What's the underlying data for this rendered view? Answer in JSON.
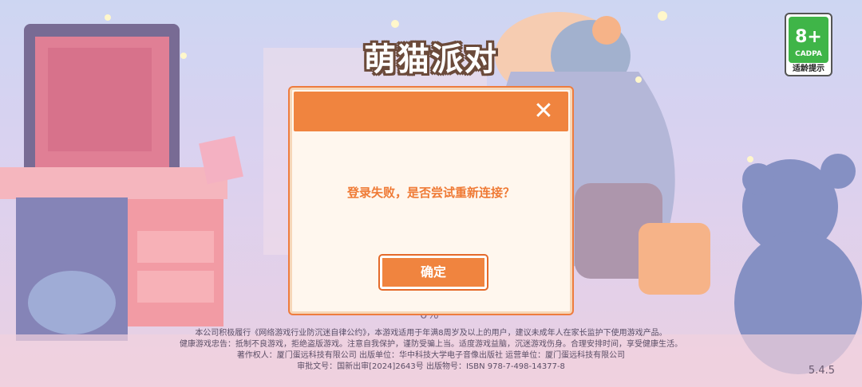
{
  "game": {
    "title": "萌猫派对"
  },
  "age_rating": {
    "age": "8+",
    "org": "CADPA",
    "hint": "适龄提示"
  },
  "dialog": {
    "close_symbol": "✕",
    "message": "登录失败，是否尝试重新连接？",
    "confirm_label": "确定"
  },
  "loading": {
    "progress_text": "0%"
  },
  "footer": {
    "lines": [
      "本公司积极履行《网络游戏行业防沉迷自律公约》，本游戏适用于年满8周岁及以上的用户，建议未成年人在家长监护下使用游戏产品。",
      "健康游戏忠告：抵制不良游戏，拒绝盗版游戏。注意自我保护，谨防受骗上当。适度游戏益脑，沉迷游戏伤身。合理安排时间，享受健康生活。",
      "著作权人：厦门蛋远科技有限公司 出版单位：华中科技大学电子音像出版社 运营单位：厦门蛋远科技有限公司",
      "审批文号：国新出审[2024]2643号 出版物号：ISBN 978-7-498-14377-8"
    ]
  },
  "version": "5.4.5",
  "colors": {
    "accent": "#f0843f",
    "text_accent": "#ef7a35",
    "badge_green": "#3fb548"
  },
  "icons": {
    "close": "close-icon"
  }
}
